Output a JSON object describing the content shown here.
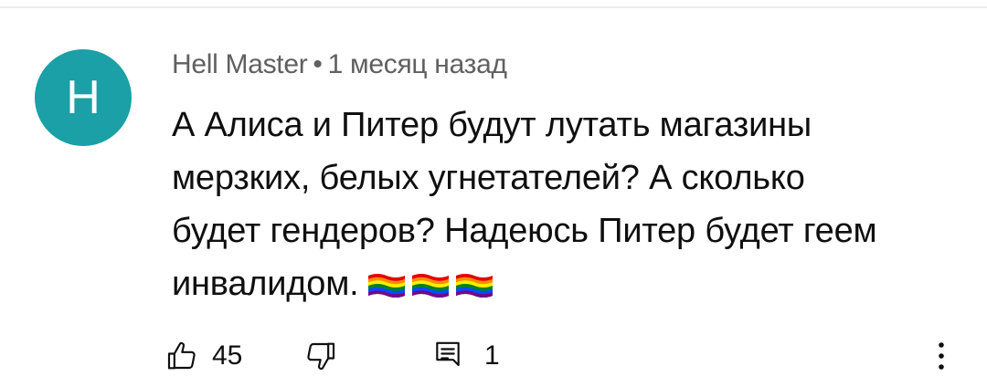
{
  "comment": {
    "author": "Hell Master",
    "separator": "•",
    "time": "1 месяц назад",
    "avatar": {
      "letter": "H",
      "color": "#1aa0a6"
    },
    "text_lines": [
      "А Алиса и Питер будут лутать магазины",
      "мерзких, белых угнетателей? А сколько",
      "будет гендеров? Надеюсь Питер будет геем",
      "инвалидом."
    ],
    "emoji": [
      "rainbow-flag",
      "rainbow-flag",
      "rainbow-flag"
    ],
    "likes": "45",
    "replies": "1"
  },
  "icons": {
    "like": "thumb-up-icon",
    "dislike": "thumb-down-icon",
    "reply": "reply-comment-icon",
    "more": "more-vertical-icon"
  }
}
